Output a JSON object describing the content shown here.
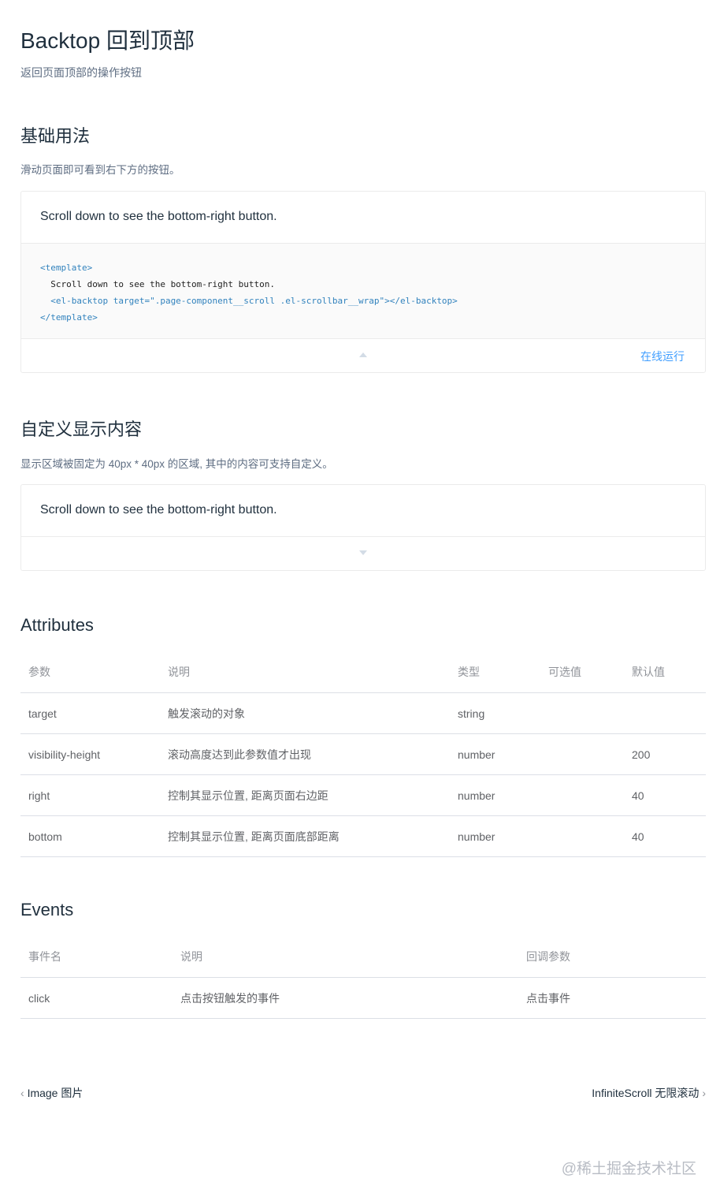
{
  "page": {
    "title": "Backtop 回到顶部",
    "description": "返回页面顶部的操作按钮"
  },
  "basic": {
    "title": "基础用法",
    "description": "滑动页面即可看到右下方的按钮。",
    "demo_text": "Scroll down to see the bottom-right button.",
    "code": {
      "line1": "<template>",
      "line2": "  Scroll down to see the bottom-right button.",
      "line3": "  <el-backtop target=\".page-component__scroll .el-scrollbar__wrap\"></el-backtop>",
      "line4": "</template>"
    },
    "run_label": "在线运行",
    "toggle_icon": "caret-up-icon"
  },
  "custom": {
    "title": "自定义显示内容",
    "description": "显示区域被固定为 40px * 40px 的区域, 其中的内容可支持自定义。",
    "demo_text": "Scroll down to see the bottom-right button.",
    "toggle_icon": "caret-down-icon"
  },
  "attributes": {
    "title": "Attributes",
    "headers": [
      "参数",
      "说明",
      "类型",
      "可选值",
      "默认值"
    ],
    "rows": [
      [
        "target",
        "触发滚动的对象",
        "string",
        "",
        ""
      ],
      [
        "visibility-height",
        "滚动高度达到此参数值才出现",
        "number",
        "",
        "200"
      ],
      [
        "right",
        "控制其显示位置, 距离页面右边距",
        "number",
        "",
        "40"
      ],
      [
        "bottom",
        "控制其显示位置, 距离页面底部距离",
        "number",
        "",
        "40"
      ]
    ]
  },
  "events": {
    "title": "Events",
    "headers": [
      "事件名",
      "说明",
      "回调参数"
    ],
    "rows": [
      [
        "click",
        "点击按钮触发的事件",
        "点击事件"
      ]
    ]
  },
  "footer": {
    "prev_label": "Image 图片",
    "next_label": "InfiniteScroll 无限滚动",
    "prev_icon": "chevron-left-icon",
    "next_icon": "chevron-right-icon"
  },
  "watermark": "@稀土掘金技术社区",
  "colors": {
    "text_primary": "#1f2f3d",
    "text_secondary": "#5e6d82",
    "link": "#409eff",
    "border": "#ebebeb"
  }
}
